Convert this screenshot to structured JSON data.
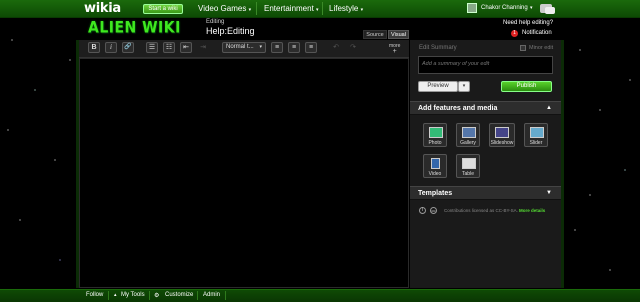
{
  "globalnav": {
    "logo": "wikia",
    "start_wiki": "Start a wiki",
    "items": [
      {
        "label": "Video Games",
        "caret": "▾"
      },
      {
        "label": "Entertainment",
        "caret": "▾"
      },
      {
        "label": "Lifestyle",
        "caret": "▾"
      }
    ],
    "user_name": "Chakor Channing",
    "user_caret": "▾"
  },
  "header": {
    "wiki_logo": "ALIEN WIKI",
    "editing_label": "Editing",
    "page_title": "Help:Editing",
    "tabs": [
      "Source",
      "Visual"
    ],
    "need_help": "Need help editing?",
    "notification_count": "1",
    "notification_label": "Notification"
  },
  "toolbar": {
    "bold": "B",
    "italic": "i",
    "link": "🔗",
    "bullets": "☰",
    "numbers": "☷",
    "outdent": "⇤",
    "indent": "⇥",
    "format_select": "Normal t...",
    "align_left": "≡",
    "align_center": "≡",
    "align_right": "≡",
    "undo": "↶",
    "redo": "↷",
    "more": "more"
  },
  "summary": {
    "label": "Edit Summary",
    "minor_label": "Minor edit",
    "placeholder": "Add a summary of your edit",
    "preview": "Preview",
    "preview_caret": "▾",
    "publish": "Publish"
  },
  "features": {
    "title": "Add features and media",
    "arrow": "▲",
    "items": [
      "Photo",
      "Gallery",
      "Slideshow",
      "Slider",
      "Video",
      "Table"
    ]
  },
  "templates": {
    "title": "Templates",
    "arrow": "▼"
  },
  "license": {
    "text": "Contributions licensed as CC-BY-SA.",
    "more": "More details"
  },
  "footer": {
    "follow": "Follow",
    "mytools": "My Tools",
    "customize": "Customize",
    "admin": "Admin"
  },
  "colors": {
    "brand_green": "#1b6a0c",
    "accent": "#3fe81f",
    "publish": "#2a8d0e"
  }
}
